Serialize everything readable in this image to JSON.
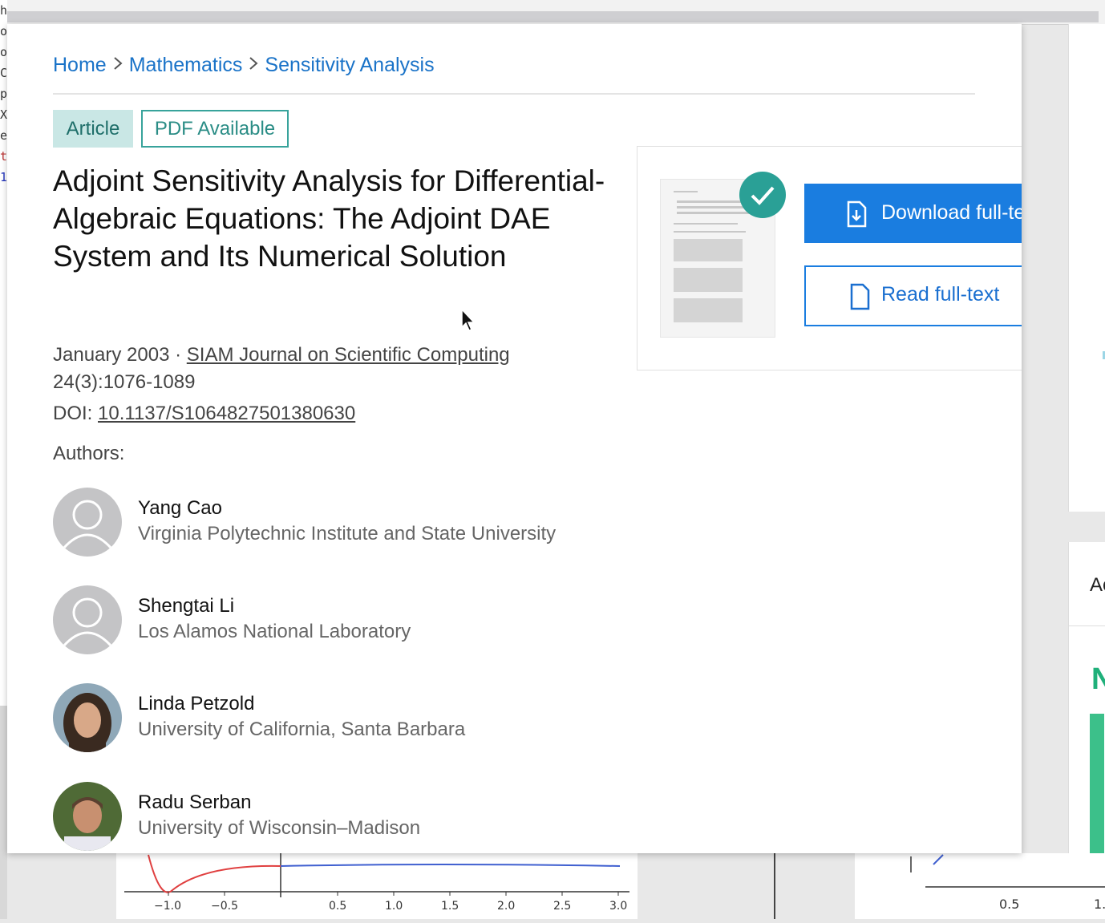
{
  "breadcrumb": {
    "home": "Home",
    "section": "Mathematics",
    "topic": "Sensitivity Analysis"
  },
  "badges": {
    "type": "Article",
    "pdf": "PDF Available"
  },
  "title": "Adjoint Sensitivity Analysis for Differential-Algebraic Equations: The Adjoint DAE System and Its Numerical Solution",
  "meta": {
    "date": "January 2003",
    "separator": " · ",
    "journal": "SIAM Journal on Scientific Computing",
    "volume": "24(3):1076-1089",
    "doi_label": "DOI: ",
    "doi": "10.1137/S1064827501380630"
  },
  "authors_label": "Authors:",
  "authors": [
    {
      "name": "Yang Cao",
      "affiliation": "Virginia Polytechnic Institute and State University"
    },
    {
      "name": "Shengtai Li",
      "affiliation": "Los Alamos National Laboratory"
    },
    {
      "name": "Linda Petzold",
      "affiliation": "University of California, Santa Barbara"
    },
    {
      "name": "Radu Serban",
      "affiliation": "University of Wisconsin–Madison"
    }
  ],
  "download": {
    "primary": "Download full-text PD",
    "secondary": "Read full-text"
  },
  "right_panel": {
    "partial_heading": "Ac"
  },
  "left_code": [
    "h",
    "o",
    "o",
    "C",
    "p",
    "X",
    "e",
    "t",
    "1"
  ],
  "background_plot": {
    "ticks_left": [
      "−1.0",
      "−0.5",
      "0.5",
      "1.0",
      "1.5",
      "2.0",
      "2.5",
      "3.0"
    ],
    "ticks_right": [
      "0.5",
      "1."
    ]
  },
  "colors": {
    "link": "#1a73c8",
    "primary_button": "#1a7de0",
    "badge_teal": "#2aa096"
  }
}
